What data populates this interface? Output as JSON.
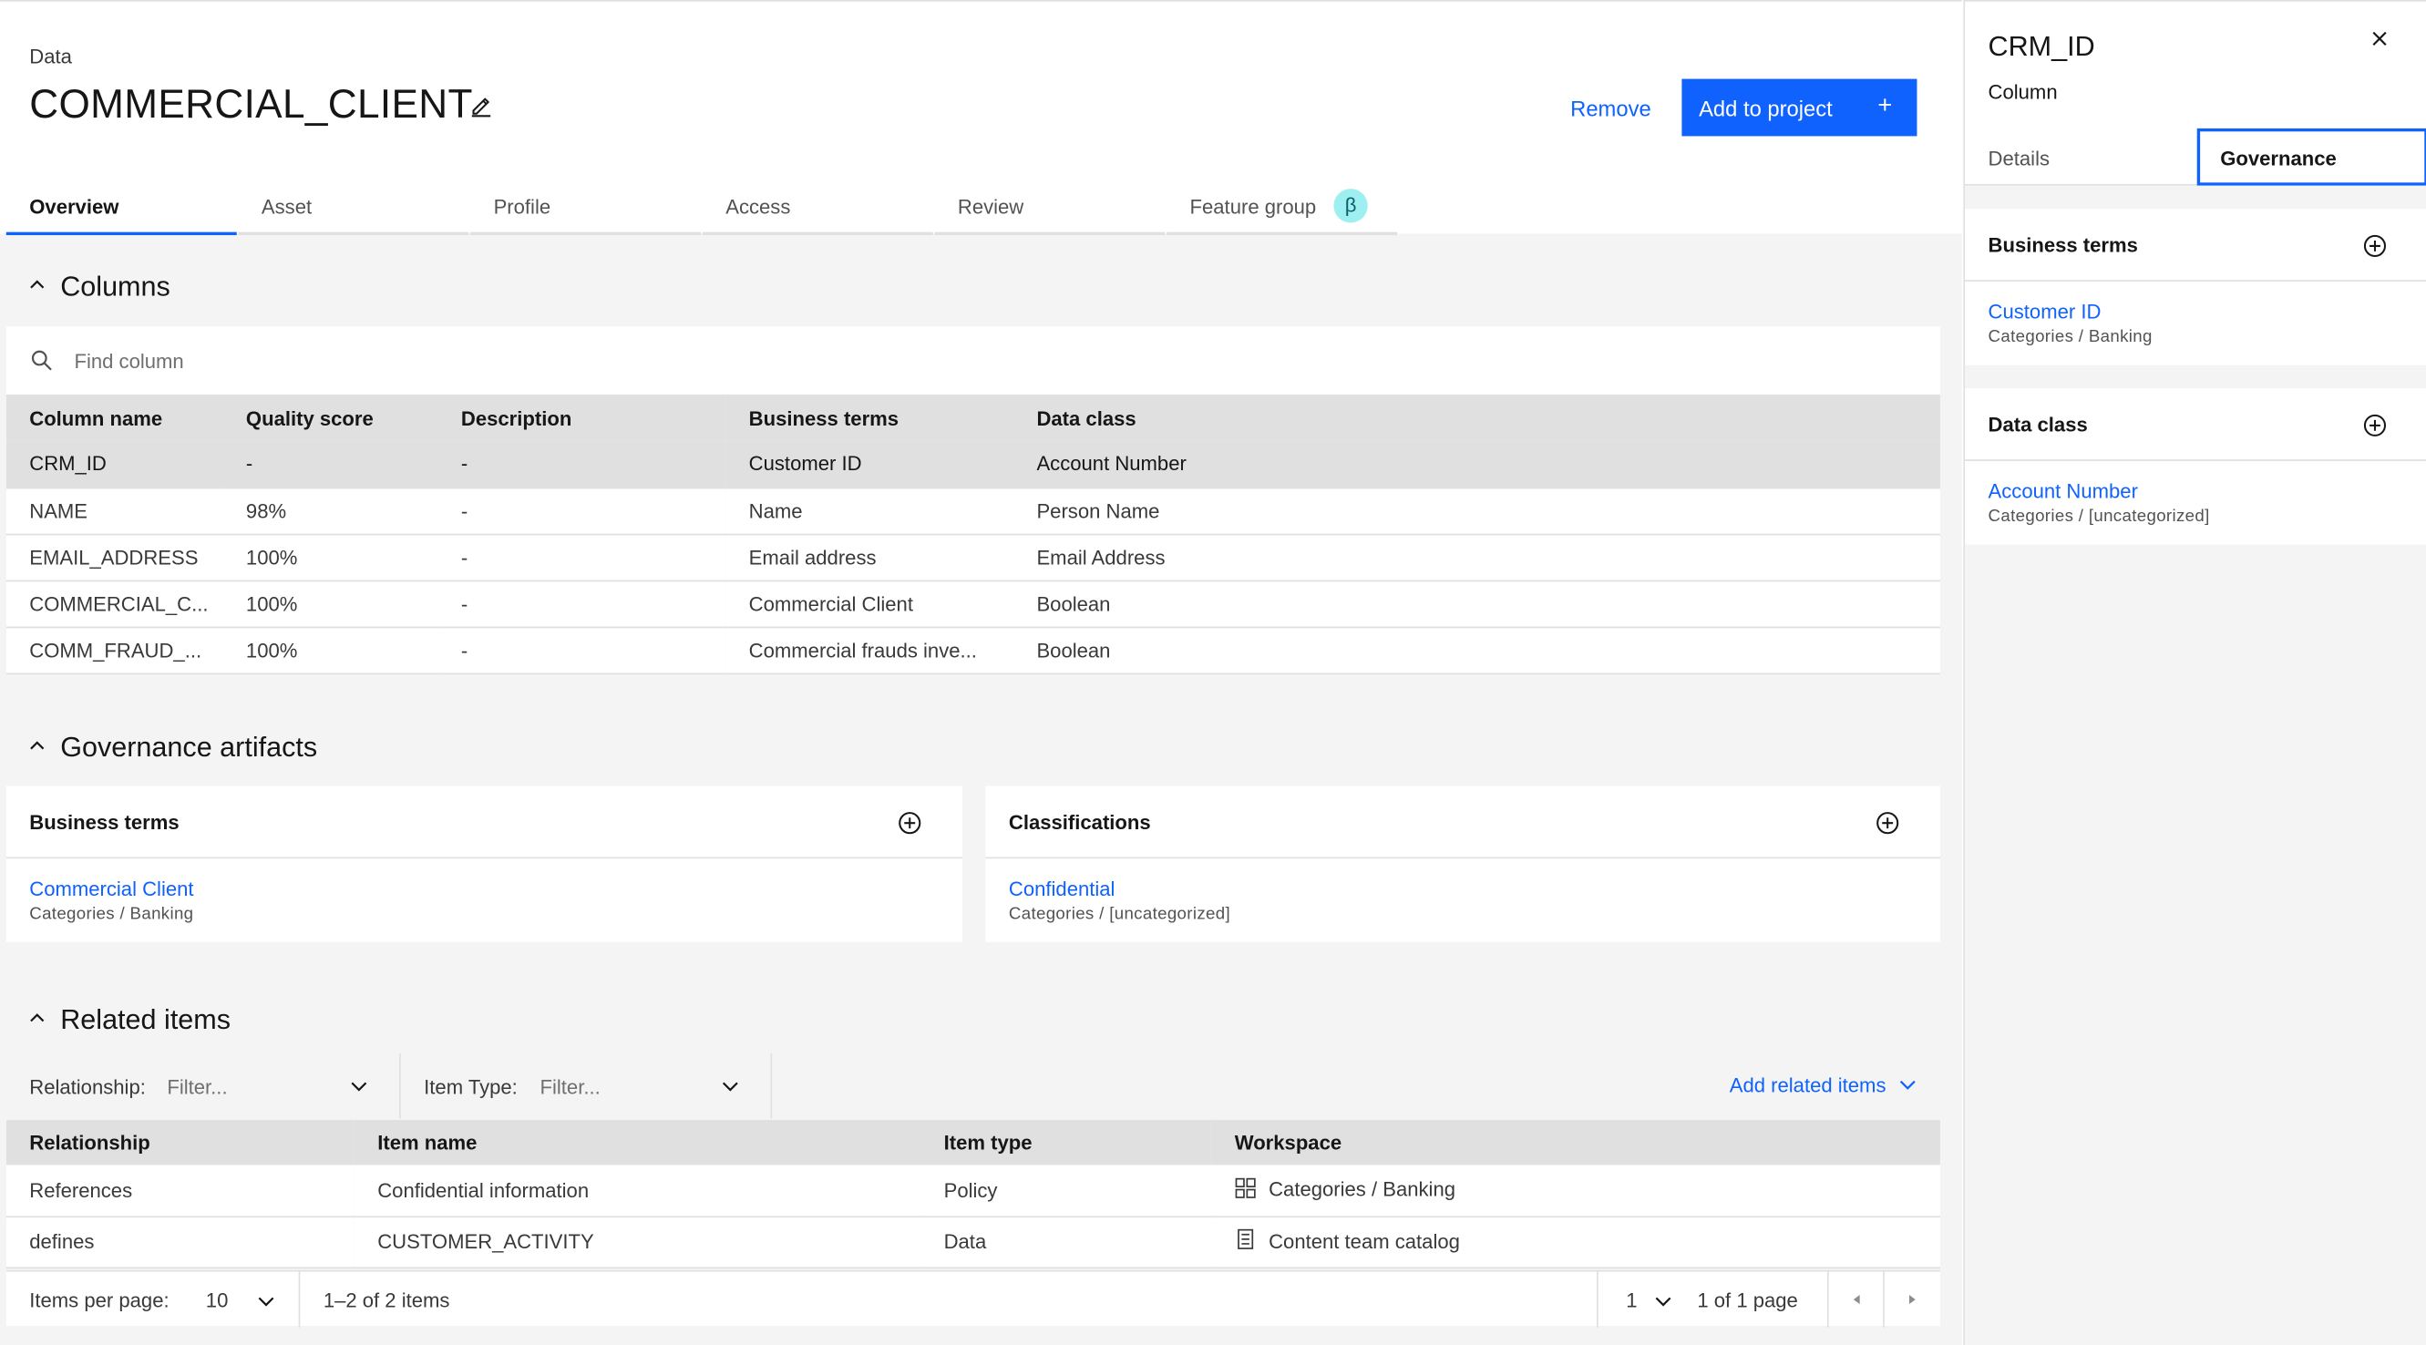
{
  "header": {
    "breadcrumb": "Data",
    "title": "COMMERCIAL_CLIENT",
    "edit_icon": "pencil-icon",
    "remove_label": "Remove",
    "add_label": "Add to project",
    "add_icon": "plus-icon"
  },
  "tabs": [
    {
      "label": "Overview",
      "active": true
    },
    {
      "label": "Asset"
    },
    {
      "label": "Profile"
    },
    {
      "label": "Access"
    },
    {
      "label": "Review"
    },
    {
      "label": "Feature group",
      "badge": "β"
    }
  ],
  "columns_section": {
    "title": "Columns",
    "search_placeholder": "Find column",
    "headers": [
      "Column name",
      "Quality score",
      "Description",
      "Business terms",
      "Data class"
    ],
    "rows": [
      [
        "CRM_ID",
        "-",
        "-",
        "Customer ID",
        "Account Number"
      ],
      [
        "NAME",
        "98%",
        "-",
        "Name",
        "Person Name"
      ],
      [
        "EMAIL_ADDRESS",
        "100%",
        "-",
        "Email address",
        "Email Address"
      ],
      [
        "COMMERCIAL_C...",
        "100%",
        "-",
        "Commercial Client",
        "Boolean"
      ],
      [
        "COMM_FRAUD_...",
        "100%",
        "-",
        "Commercial frauds inve...",
        "Boolean"
      ]
    ]
  },
  "governance_section": {
    "title": "Governance artifacts",
    "business_terms": {
      "title": "Business terms",
      "term": "Commercial Client",
      "meta": "Categories  /  Banking"
    },
    "classifications": {
      "title": "Classifications",
      "term": "Confidential",
      "meta": "Categories  /  [uncategorized]"
    }
  },
  "related_section": {
    "title": "Related items",
    "relationship_label": "Relationship:",
    "relationship_value": "Filter...",
    "item_type_label": "Item Type:",
    "item_type_value": "Filter...",
    "add_related": "Add related items",
    "headers": [
      "Relationship",
      "Item name",
      "Item type",
      "Workspace"
    ],
    "rows": [
      {
        "relationship": "References",
        "item_name": "Confidential information",
        "item_type": "Policy",
        "workspace": "Categories / Banking",
        "icon": "category-grid-icon"
      },
      {
        "relationship": "defines",
        "item_name": "CUSTOMER_ACTIVITY",
        "item_type": "Data",
        "workspace": "Content team catalog",
        "icon": "catalog-icon"
      }
    ],
    "pager": {
      "items_per_page_label": "Items per page:",
      "items_per_page": "10",
      "range": "1–2 of 2 items",
      "page": "1",
      "of_pages": "1 of 1 page"
    }
  },
  "side_panel": {
    "title": "CRM_ID",
    "subtitle": "Column",
    "tabs": [
      "Details",
      "Governance"
    ],
    "business_terms": {
      "title": "Business terms",
      "term": "Customer ID",
      "meta": "Categories  /  Banking"
    },
    "data_class": {
      "title": "Data class",
      "term": "Account Number",
      "meta": "Categories  /  [uncategorized]"
    }
  },
  "colors": {
    "accent": "#0f62fe",
    "badge_bg": "#9ef0f0",
    "surface": "#f4f4f4",
    "header_row": "#e0e0e0"
  }
}
